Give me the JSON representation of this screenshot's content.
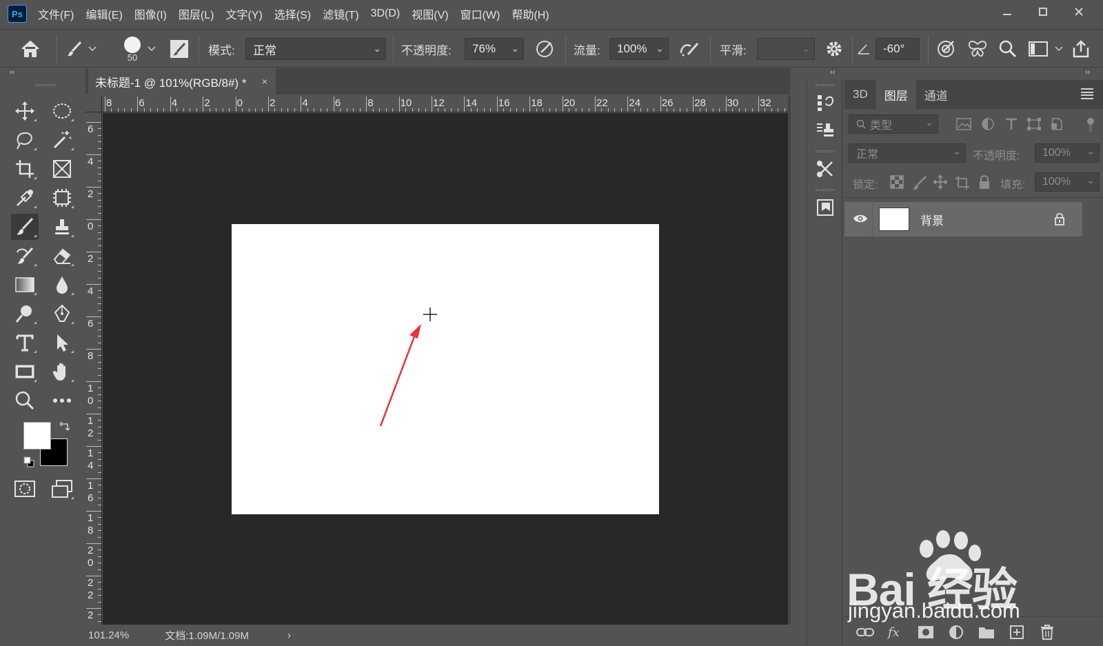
{
  "app": {
    "logo": "Ps"
  },
  "menu": [
    "文件(F)",
    "编辑(E)",
    "图像(I)",
    "图层(L)",
    "文字(Y)",
    "选择(S)",
    "滤镜(T)",
    "3D(D)",
    "视图(V)",
    "窗口(W)",
    "帮助(H)"
  ],
  "options": {
    "brush_size": "50",
    "mode_label": "模式:",
    "mode_value": "正常",
    "opacity_label": "不透明度:",
    "opacity_value": "76%",
    "flow_label": "流量:",
    "flow_value": "100%",
    "smoothing_label": "平滑:",
    "smoothing_value": "",
    "angle_value": "-60°"
  },
  "document_tab": {
    "title": "未标题-1 @ 101%(RGB/8#) *",
    "close": "×"
  },
  "ruler_top_labels": [
    "8",
    "6",
    "4",
    "2",
    "0",
    "2",
    "4",
    "6",
    "8",
    "10",
    "12",
    "14",
    "16",
    "18",
    "20",
    "22",
    "24",
    "26",
    "28",
    "30",
    "32"
  ],
  "ruler_left_labels": [
    "6",
    "4",
    "2",
    "0",
    "2",
    "4",
    "6",
    "8",
    "1 0",
    "1 2",
    "1 4",
    "1 6",
    "1 8",
    "2 0",
    "2 2",
    "2"
  ],
  "status": {
    "zoom": "101.24%",
    "doc_info": "文档:1.09M/1.09M",
    "arrow": "›"
  },
  "layers_panel": {
    "tabs": [
      "3D",
      "图层",
      "通道"
    ],
    "active_tab": "图层",
    "filter_placeholder": "类型",
    "blend_mode": "正常",
    "opacity_label": "不透明度:",
    "opacity_value": "100%",
    "lock_label": "锁定:",
    "fill_label": "填充:",
    "fill_value": "100%",
    "layers": [
      {
        "name": "背景",
        "visible": true,
        "locked": true
      }
    ]
  },
  "watermark": {
    "brand": "Bai  经验",
    "url": "jingyan.baidu.com"
  },
  "colors": {
    "foreground": "#ffffff",
    "background": "#000000",
    "annotation_arrow": "#e8323c"
  }
}
